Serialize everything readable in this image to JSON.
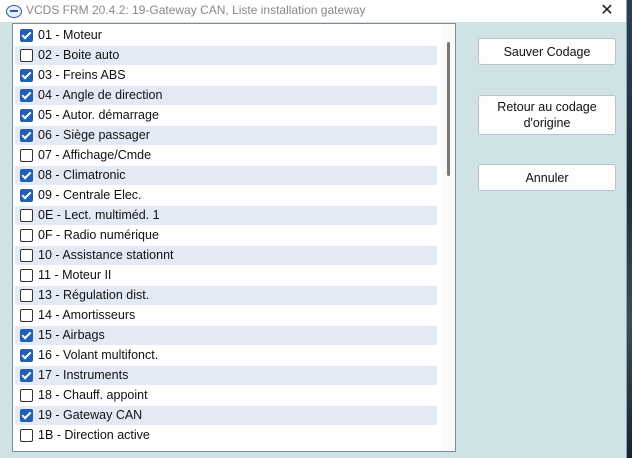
{
  "window": {
    "title": "VCDS FRM 20.4.2: 19-Gateway CAN,  Liste installation gateway",
    "close_symbol": "✕"
  },
  "modules": [
    {
      "label": "01 - Moteur",
      "checked": true
    },
    {
      "label": "02 - Boite auto",
      "checked": false
    },
    {
      "label": "03 - Freins ABS",
      "checked": true
    },
    {
      "label": "04 - Angle de direction",
      "checked": true
    },
    {
      "label": "05 - Autor. démarrage",
      "checked": true
    },
    {
      "label": "06 - Siège passager",
      "checked": true
    },
    {
      "label": "07 - Affichage/Cmde",
      "checked": false
    },
    {
      "label": "08 - Climatronic",
      "checked": true
    },
    {
      "label": "09 - Centrale Elec.",
      "checked": true
    },
    {
      "label": "0E - Lect. multiméd. 1",
      "checked": false
    },
    {
      "label": "0F - Radio numérique",
      "checked": false
    },
    {
      "label": "10 - Assistance stationnt",
      "checked": false
    },
    {
      "label": "11 - Moteur II",
      "checked": false
    },
    {
      "label": "13 - Régulation dist.",
      "checked": false
    },
    {
      "label": "14 - Amortisseurs",
      "checked": false
    },
    {
      "label": "15 - Airbags",
      "checked": true
    },
    {
      "label": "16 - Volant multifonct.",
      "checked": true
    },
    {
      "label": "17 - Instruments",
      "checked": true
    },
    {
      "label": "18 - Chauff. appoint",
      "checked": false
    },
    {
      "label": "19 - Gateway CAN",
      "checked": true
    },
    {
      "label": "1B - Direction active",
      "checked": false
    }
  ],
  "buttons": {
    "save": "Sauver Codage",
    "restore_line1": "Retour au codage",
    "restore_line2": "d'origine",
    "cancel": "Annuler"
  },
  "icons": {
    "app": "vcds-app-icon",
    "close": "close-icon"
  }
}
